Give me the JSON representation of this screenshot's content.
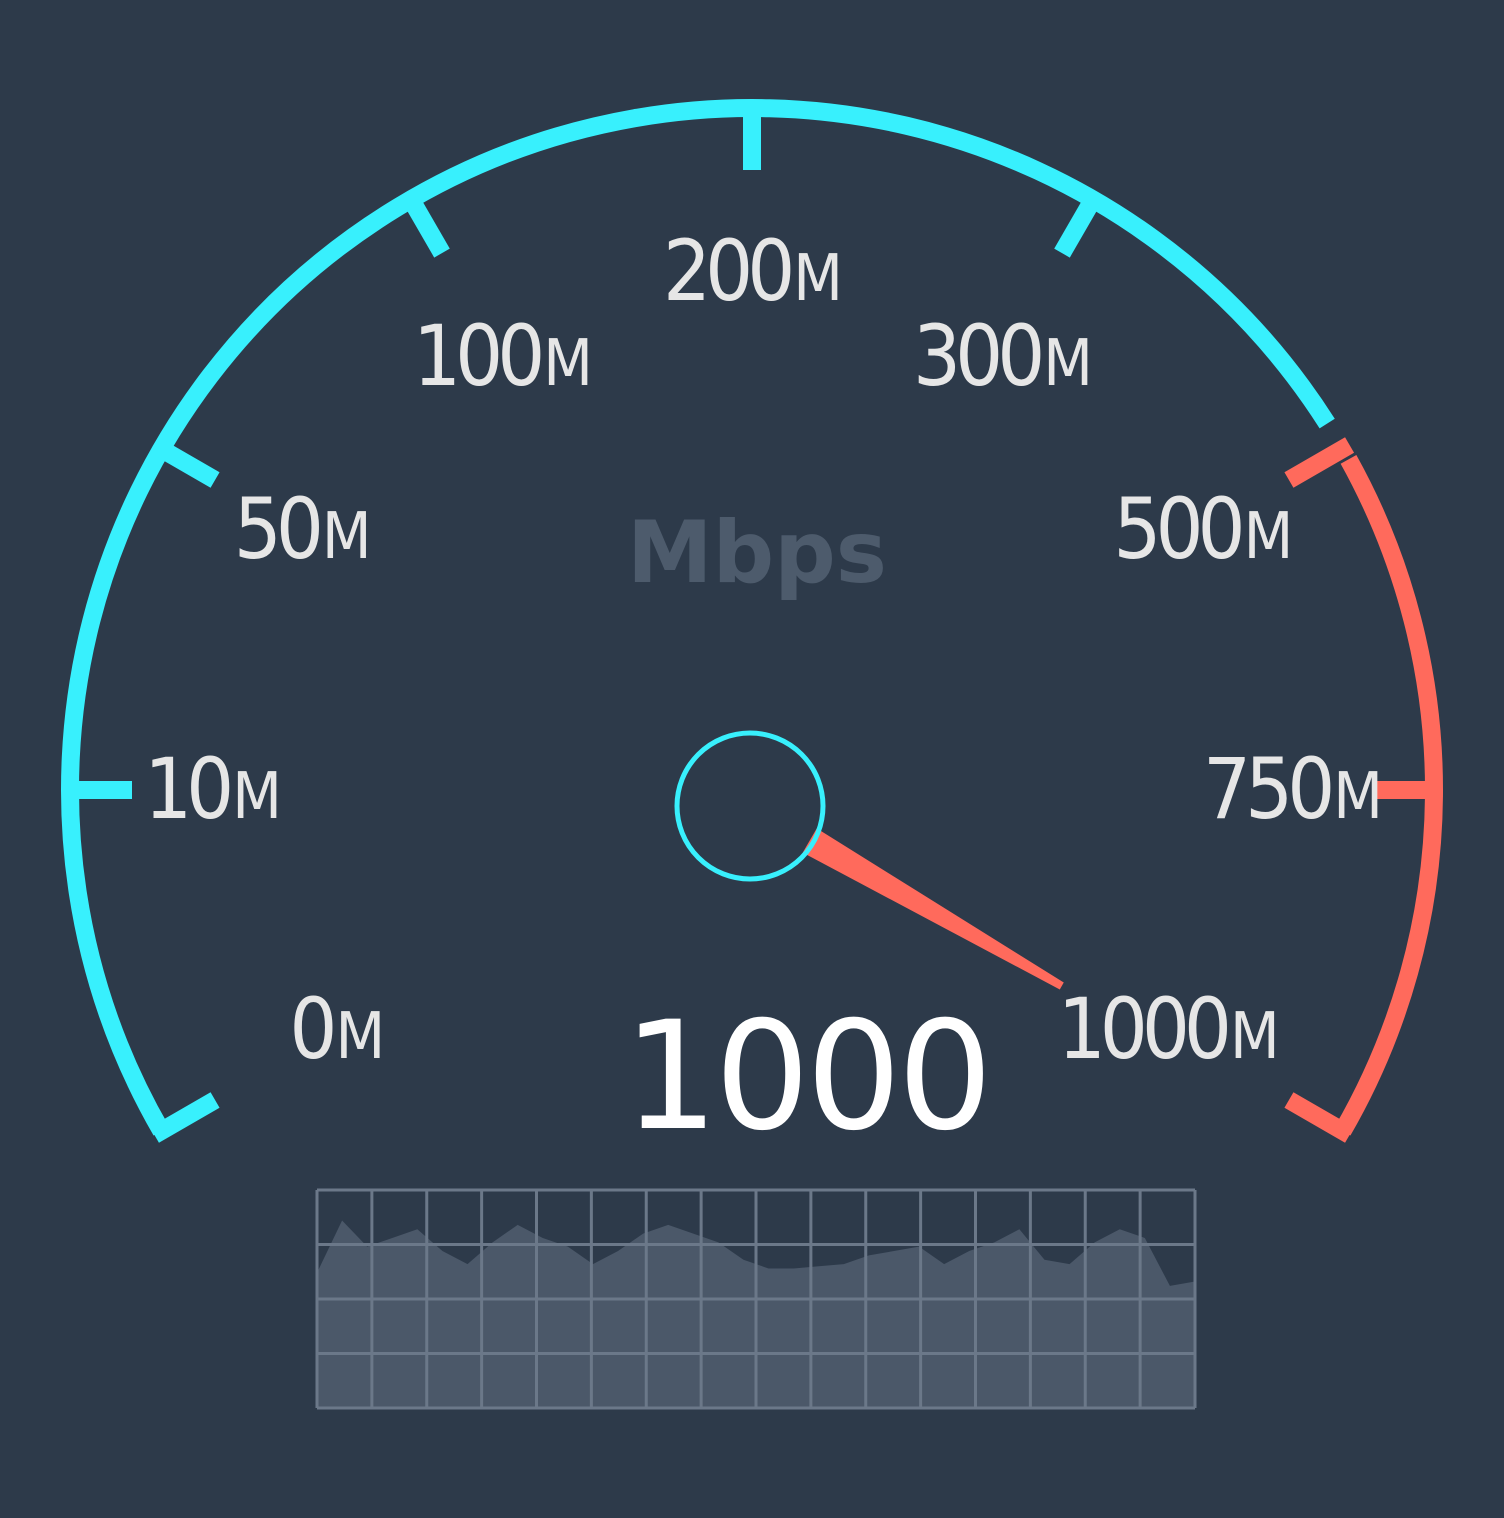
{
  "unit_label": "Mbps",
  "readout": "1000",
  "ticks": [
    {
      "num": "0",
      "unit": "M"
    },
    {
      "num": "10",
      "unit": "M"
    },
    {
      "num": "50",
      "unit": "M"
    },
    {
      "num": "100",
      "unit": "M"
    },
    {
      "num": "200",
      "unit": "M"
    },
    {
      "num": "300",
      "unit": "M"
    },
    {
      "num": "500",
      "unit": "M"
    },
    {
      "num": "750",
      "unit": "M"
    },
    {
      "num": "1000",
      "unit": "M"
    }
  ],
  "gauge": {
    "min_index": 0,
    "max_index": 8,
    "needle_index": 8,
    "warning_from_index": 6
  },
  "history": {
    "values": [
      0.62,
      0.86,
      0.74,
      0.78,
      0.82,
      0.72,
      0.66,
      0.76,
      0.84,
      0.78,
      0.74,
      0.66,
      0.72,
      0.8,
      0.84,
      0.8,
      0.76,
      0.68,
      0.64,
      0.64,
      0.65,
      0.66,
      0.7,
      0.72,
      0.74,
      0.66,
      0.72,
      0.76,
      0.82,
      0.68,
      0.66,
      0.76,
      0.82,
      0.78,
      0.56,
      0.58
    ]
  },
  "colors": {
    "background": "#2d3a4a",
    "normal": "#38f0fd",
    "warning": "#ff6a5c",
    "label": "#e6e6e6",
    "muted": "#4d5b6c",
    "grid_fill": "#4b5869",
    "grid_line": "#6b7889"
  }
}
